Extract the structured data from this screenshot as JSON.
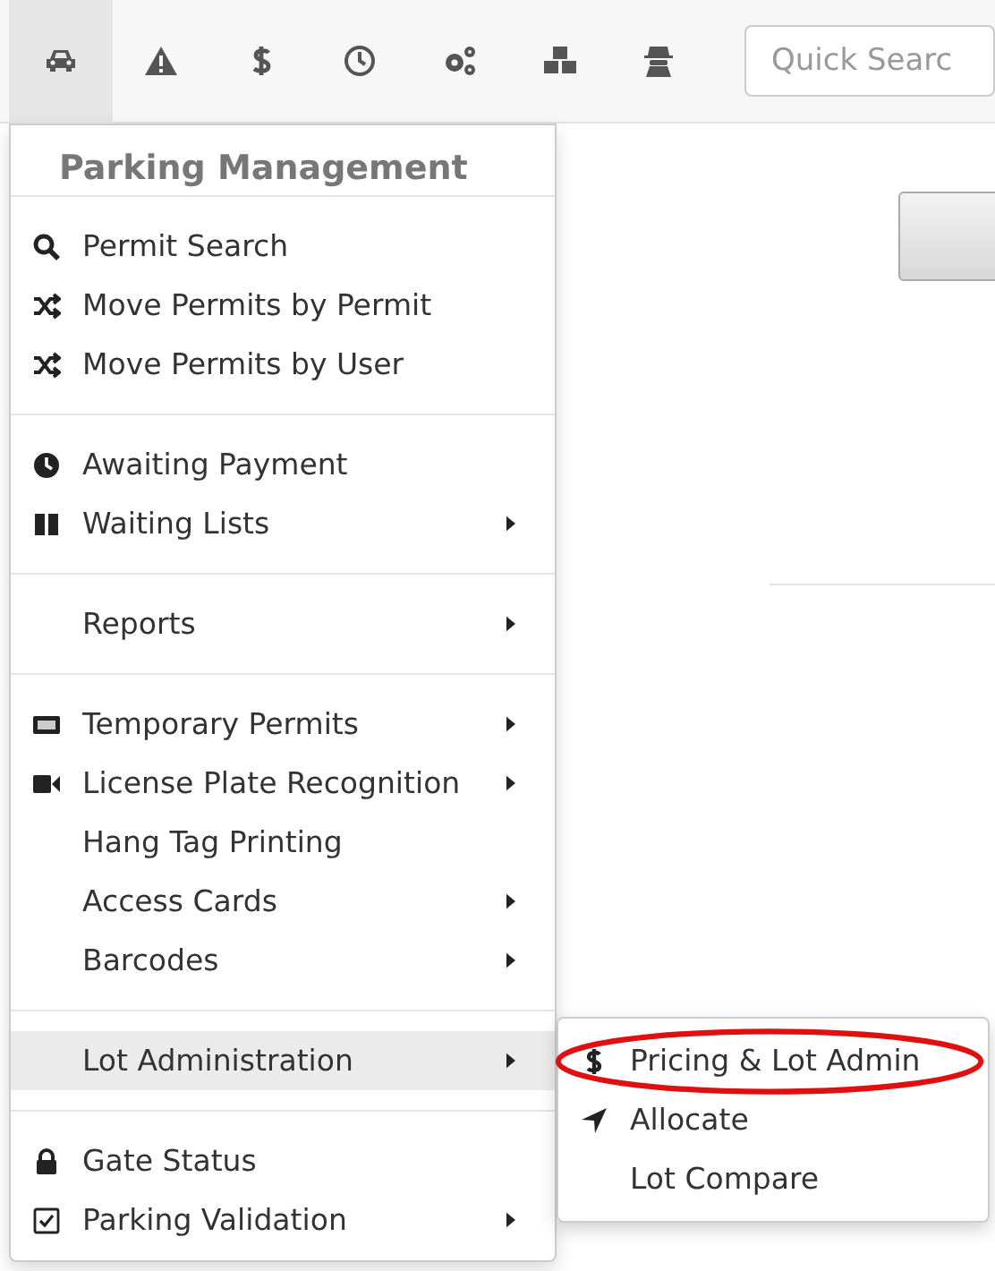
{
  "toolbar": {
    "tabs": [
      {
        "selected": true
      },
      {
        "selected": false
      },
      {
        "selected": false
      },
      {
        "selected": false
      },
      {
        "selected": false
      },
      {
        "selected": false
      },
      {
        "selected": false
      }
    ],
    "search": {
      "placeholder": "Quick Searc"
    }
  },
  "menu": {
    "title": "Parking Management",
    "sections": [
      {
        "items": [
          {
            "label": "Permit Search",
            "submenu": false,
            "selected": false
          },
          {
            "label": "Move Permits by Permit",
            "submenu": false,
            "selected": false
          },
          {
            "label": "Move Permits by User",
            "submenu": false,
            "selected": false
          }
        ]
      },
      {
        "items": [
          {
            "label": "Awaiting Payment",
            "submenu": false,
            "selected": false
          },
          {
            "label": "Waiting Lists",
            "submenu": true,
            "selected": false
          }
        ]
      },
      {
        "items": [
          {
            "label": "Reports",
            "submenu": true,
            "selected": false
          }
        ]
      },
      {
        "items": [
          {
            "label": "Temporary Permits",
            "submenu": true,
            "selected": false
          },
          {
            "label": "License Plate Recognition",
            "submenu": true,
            "selected": false
          },
          {
            "label": "Hang Tag Printing",
            "submenu": false,
            "selected": false
          },
          {
            "label": "Access Cards",
            "submenu": true,
            "selected": false
          },
          {
            "label": "Barcodes",
            "submenu": true,
            "selected": false
          }
        ]
      },
      {
        "items": [
          {
            "label": "Lot Administration",
            "submenu": true,
            "selected": true,
            "children": [
              {
                "label": "Pricing & Lot Admin",
                "circled": true
              },
              {
                "label": "Allocate",
                "circled": false
              },
              {
                "label": "Lot Compare",
                "circled": false
              }
            ]
          }
        ]
      },
      {
        "items": [
          {
            "label": "Gate Status",
            "submenu": false,
            "selected": false
          },
          {
            "label": "Parking Validation",
            "submenu": true,
            "selected": false
          }
        ]
      }
    ]
  }
}
